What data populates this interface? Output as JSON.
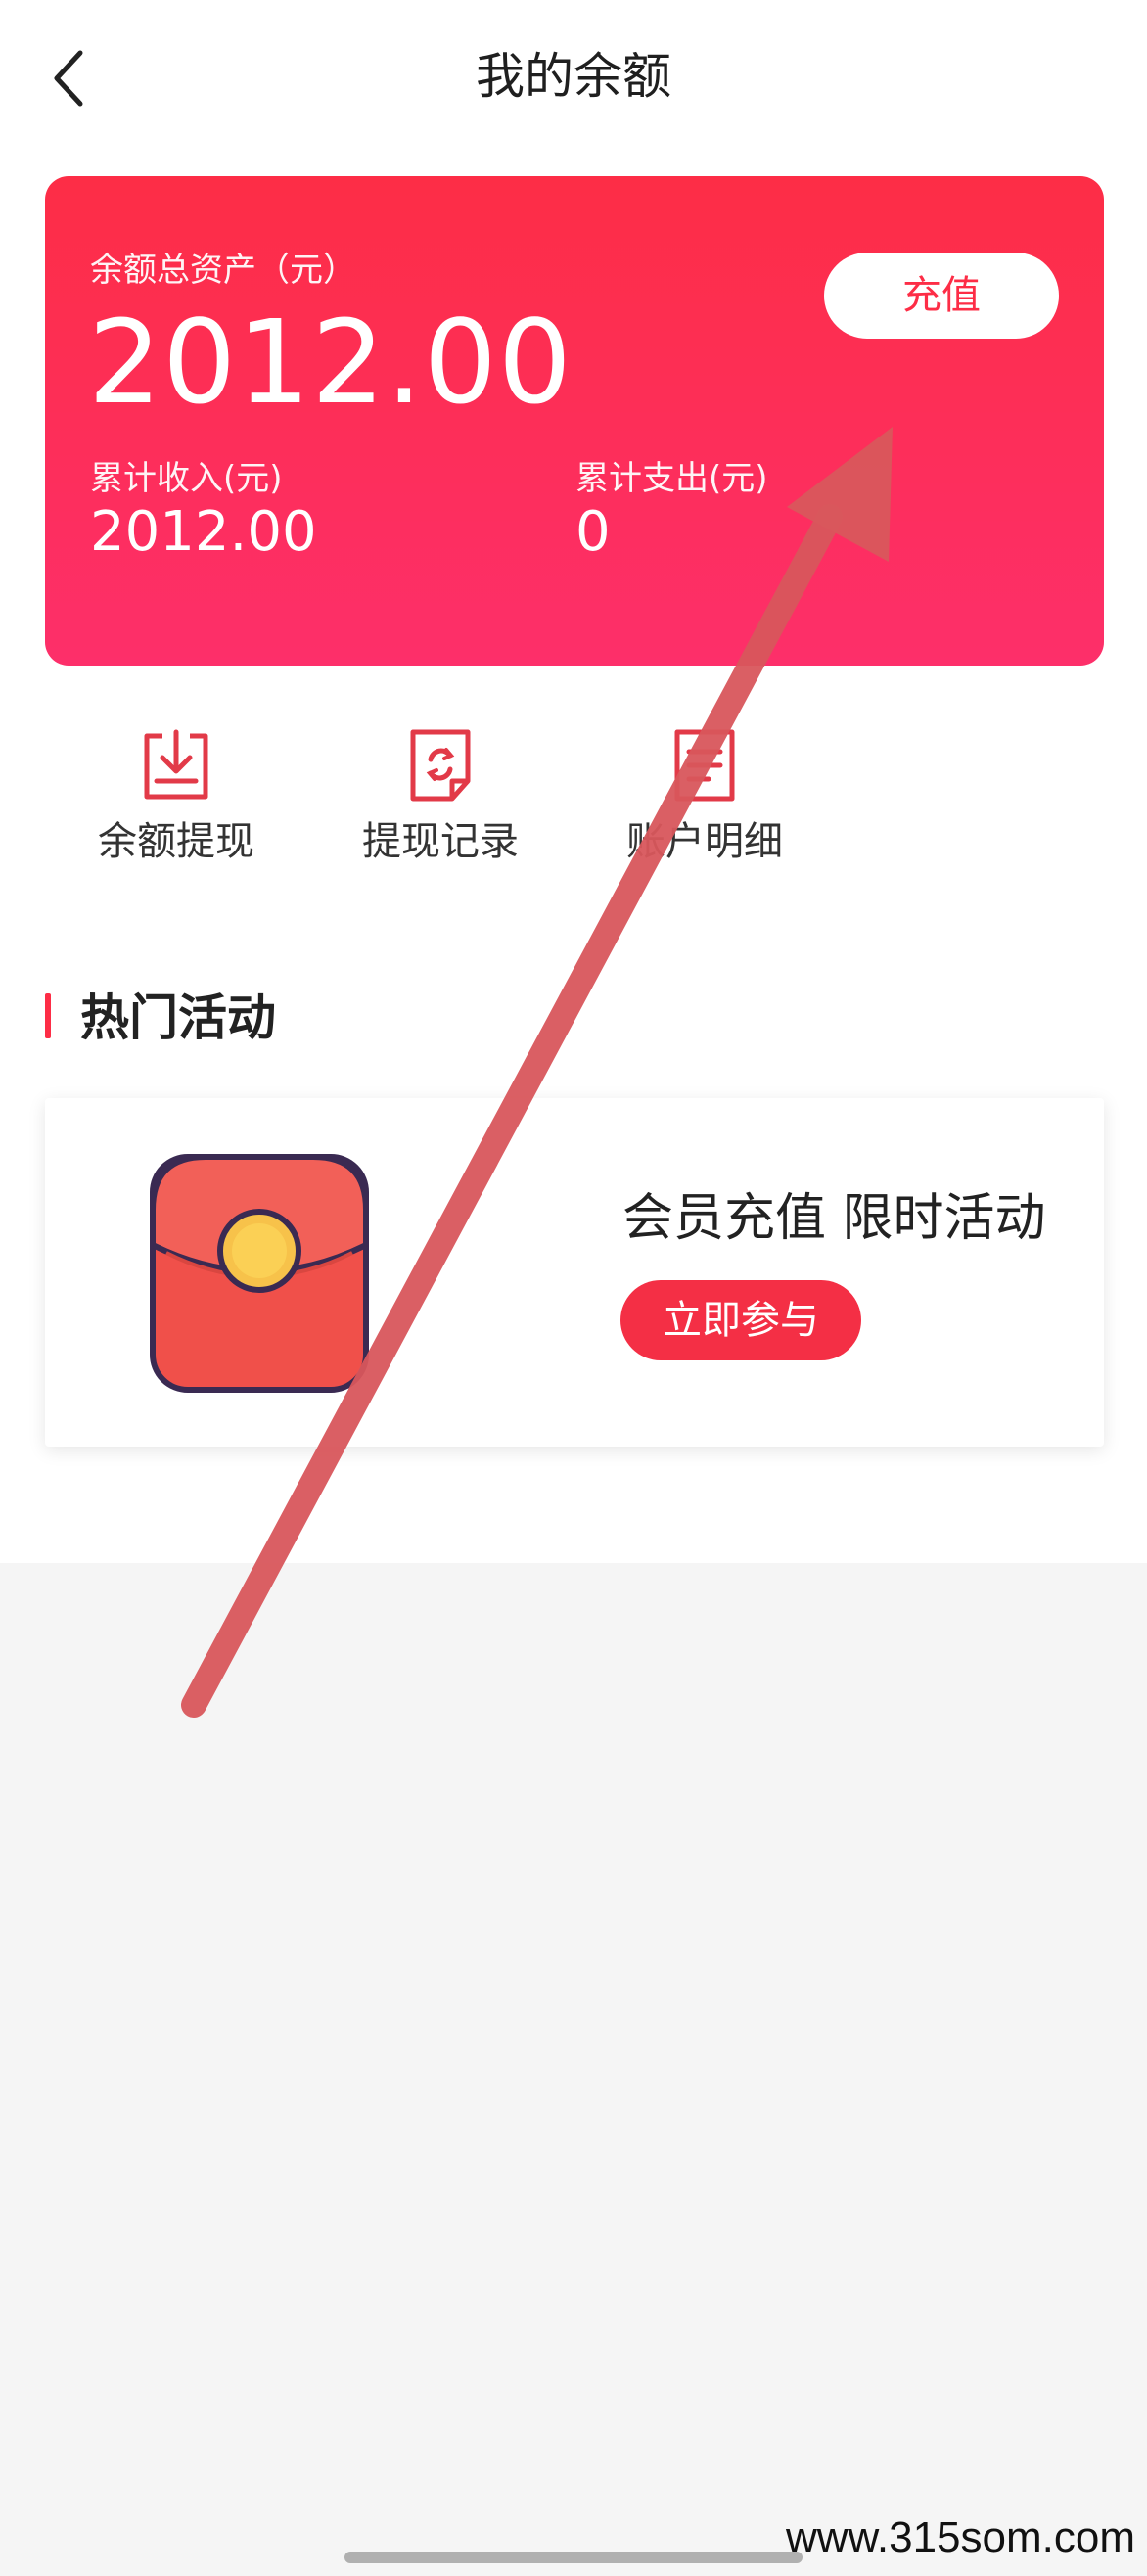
{
  "header": {
    "title": "我的余额",
    "back_icon": "chevron-left-icon"
  },
  "balance_card": {
    "total_label": "余额总资产（元）",
    "total_value": "2012.00",
    "recharge_label": "充值",
    "income_label": "累计收入(元)",
    "income_value": "2012.00",
    "expense_label": "累计支出(元)",
    "expense_value": "0",
    "gradient_top": "#fd2d46",
    "gradient_bottom": "#fd2f6a"
  },
  "actions": [
    {
      "label": "余额提现",
      "icon": "download-box-icon"
    },
    {
      "label": "提现记录",
      "icon": "refresh-document-icon"
    },
    {
      "label": "账户明细",
      "icon": "document-list-icon"
    }
  ],
  "section": {
    "title": "热门活动"
  },
  "activity": {
    "title": "会员充值 限时活动",
    "join_label": "立即参与",
    "image_icon": "red-envelope-icon"
  },
  "overlay": {
    "icon": "pointing-arrow-icon",
    "color": "#d9575c"
  },
  "watermark": "www.315som.com",
  "colors": {
    "accent": "#fd2d46",
    "button_red": "#f42f45",
    "page_gray": "#f5f5f5"
  }
}
